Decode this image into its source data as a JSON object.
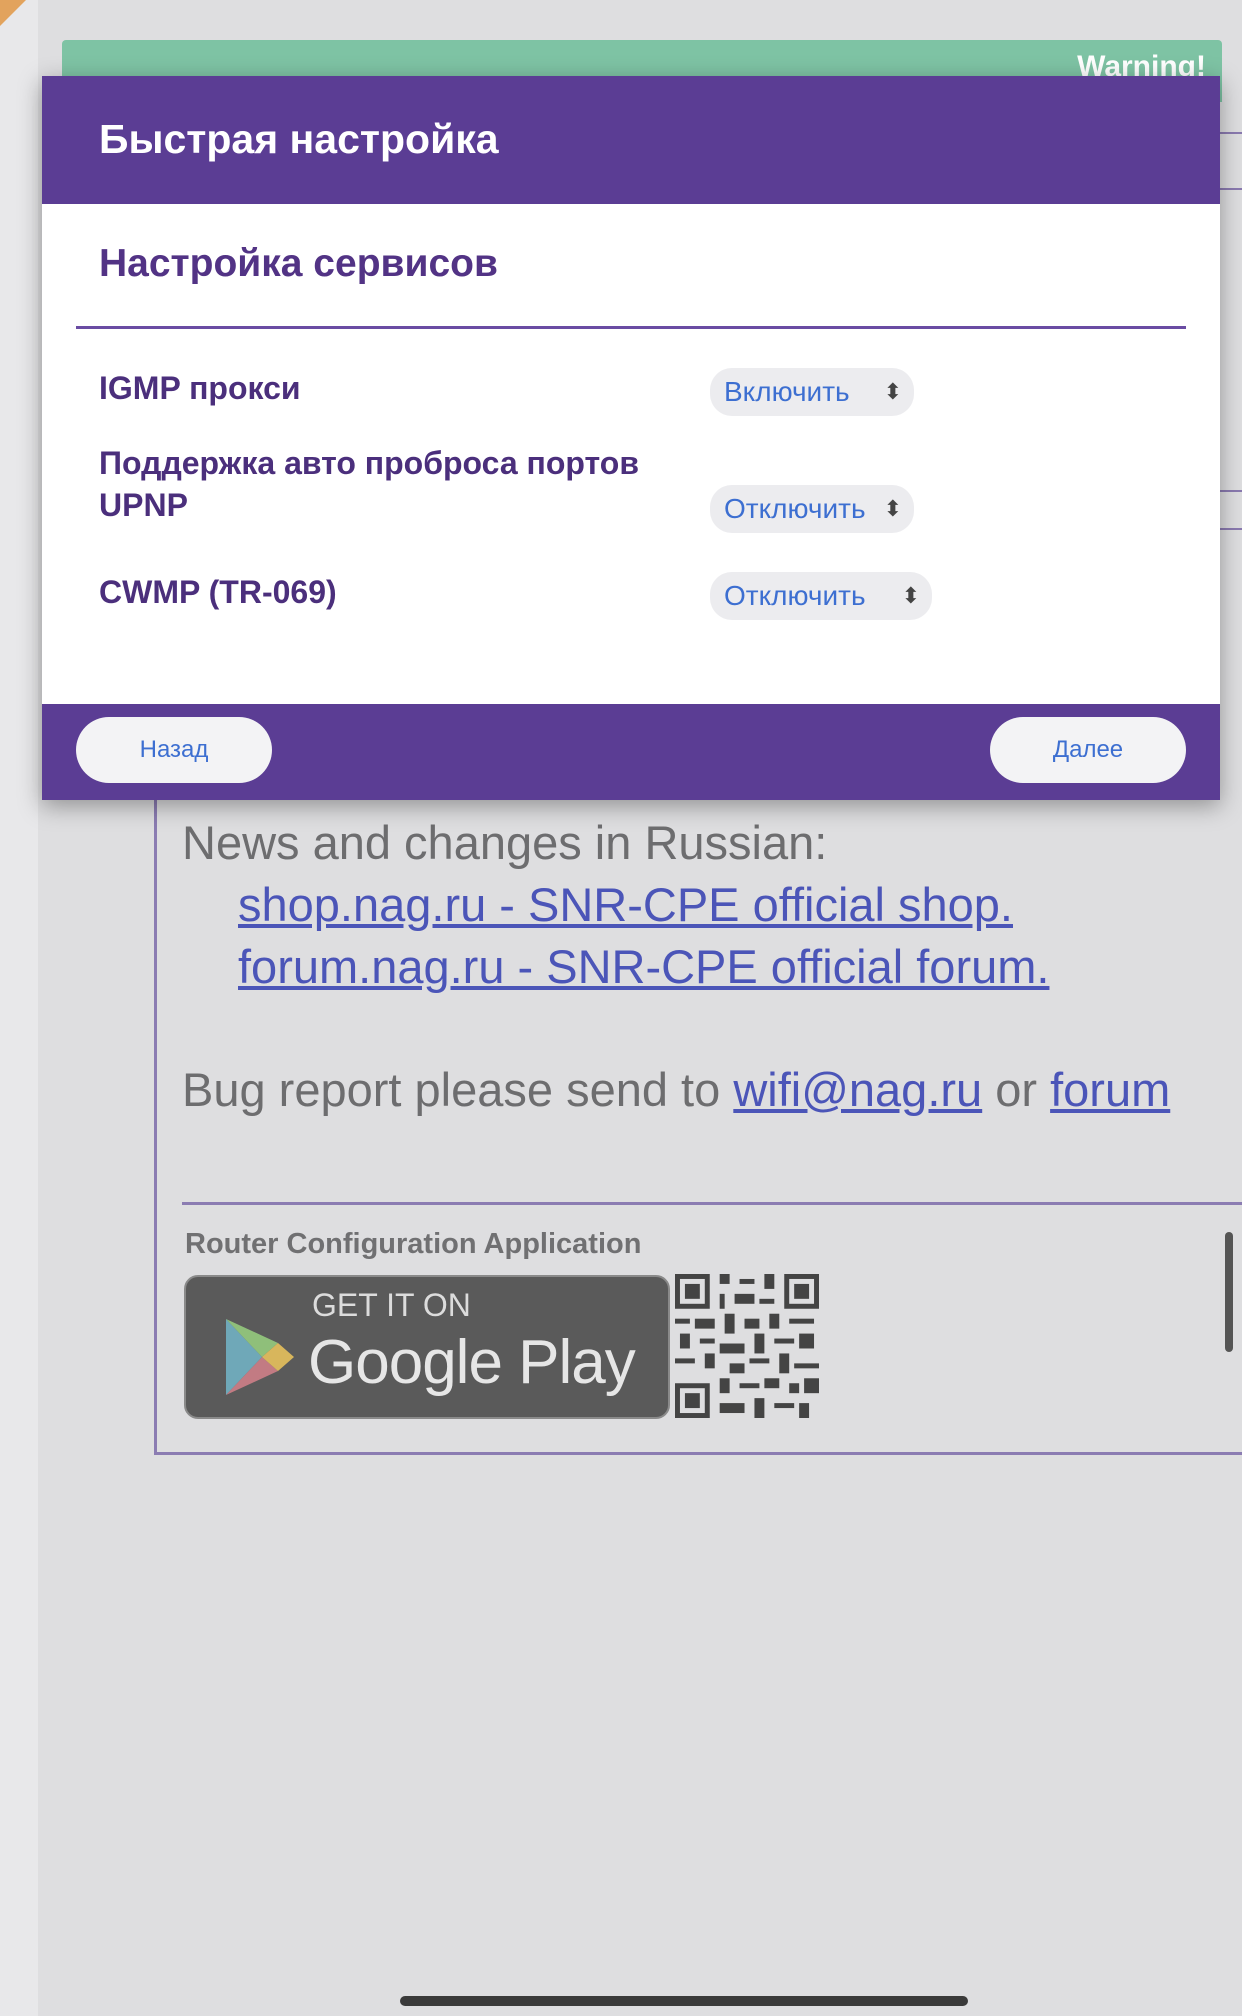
{
  "background": {
    "warning_text": "Warning!",
    "news_heading": "News and changes in Russian:",
    "news_links": [
      "shop.nag.ru - SNR-CPE official shop.",
      "forum.nag.ru - SNR-CPE official forum."
    ],
    "bug_report_prefix": "Bug report please send to ",
    "bug_email": "wifi@nag.ru",
    "bug_or": " or ",
    "bug_forum": "forum",
    "app_caption": "Router Configuration Application",
    "google_play": {
      "small": "GET IT ON",
      "big": "Google Play"
    }
  },
  "modal": {
    "title": "Быстрая настройка",
    "section_title": "Настройка сервисов",
    "rows": [
      {
        "label": "IGMP прокси",
        "value": "Включить"
      },
      {
        "label": "Поддержка авто проброса портов UPNP",
        "value": "Отключить"
      },
      {
        "label": "CWMP (TR-069)",
        "value": "Отключить"
      }
    ],
    "back_label": "Назад",
    "next_label": "Далее"
  },
  "colors": {
    "header_purple": "#5b3d94",
    "label_purple": "#4b2f7c",
    "link_blue": "#4b55b8",
    "select_text_blue": "#3d6fd1",
    "warning_green": "#7ec3a4"
  },
  "icons": [
    "chevron-updown-icon",
    "google-play-icon",
    "qr-code"
  ]
}
